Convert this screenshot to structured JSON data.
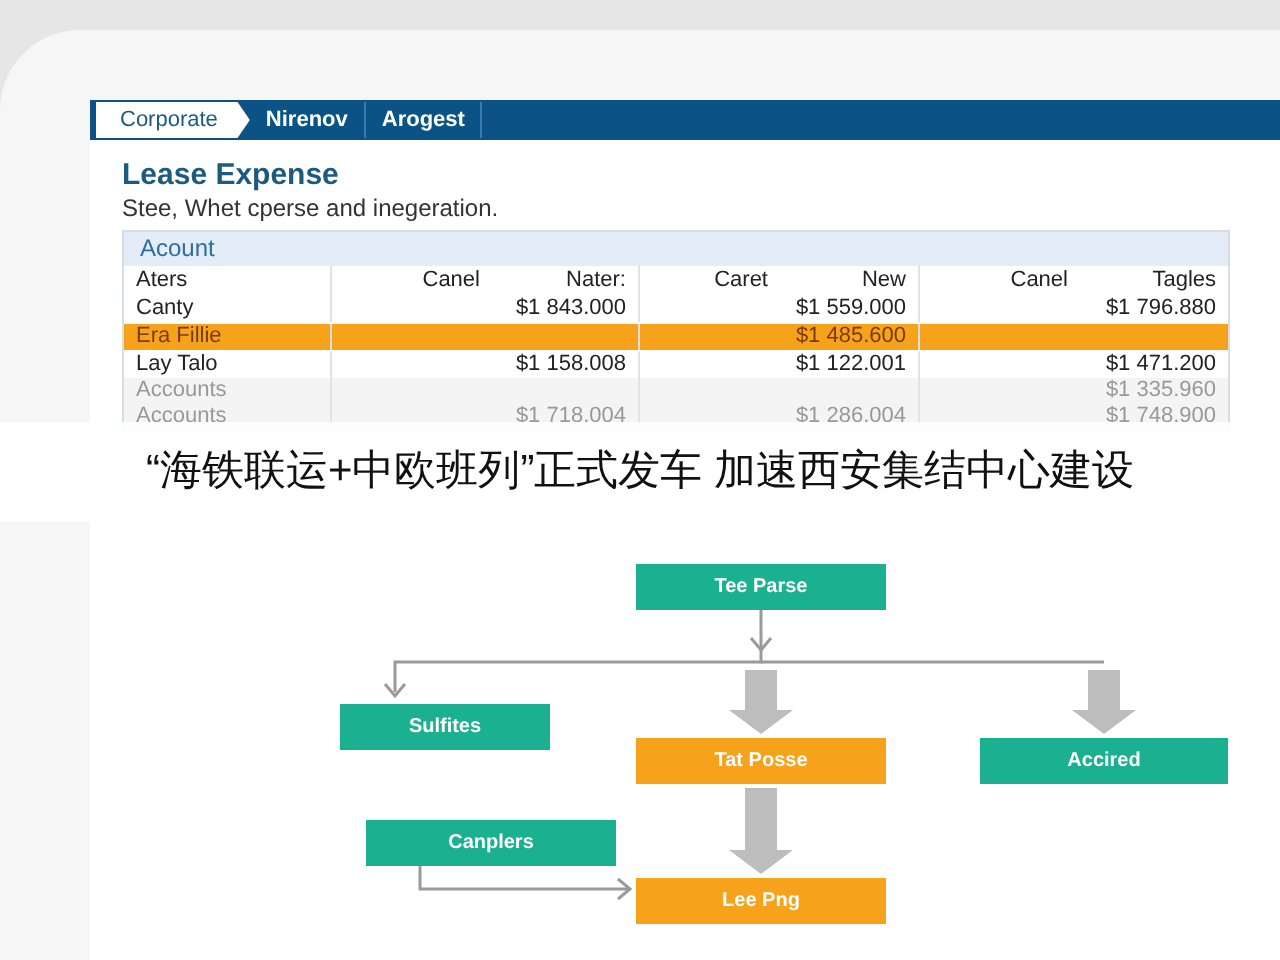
{
  "breadcrumb": [
    {
      "label": "Corporate",
      "selected": true
    },
    {
      "label": "Nirenov",
      "selected": false
    },
    {
      "label": "Arogest",
      "selected": false
    }
  ],
  "title": "Lease Expense",
  "subtitle": "Stee, Whet cperse and inegeration.",
  "table": {
    "section": "Acount",
    "columns": [
      "Aters",
      "Canel",
      "Nater:",
      "Caret",
      "New",
      "Canel",
      "Tagles"
    ],
    "rows": [
      {
        "cells": [
          "Canty",
          "",
          "$1 843.000",
          "",
          "$1 559.000",
          "",
          "$1 796.880"
        ],
        "highlighted": false
      },
      {
        "cells": [
          "Era Fillie",
          "",
          "",
          "",
          "$1 485.600",
          "",
          ""
        ],
        "highlighted": true
      },
      {
        "cells": [
          "Lay Talo",
          "",
          "$1 158.008",
          "",
          "$1 122.001",
          "",
          "$1 471.200"
        ],
        "highlighted": false
      },
      {
        "cells": [
          "Accounts",
          "",
          "",
          "",
          "",
          "",
          "$1 335.960"
        ],
        "highlighted": false
      },
      {
        "cells": [
          "Accounts",
          "",
          "$1 718.004",
          "",
          "$1 286.004",
          "",
          "$1 748.900"
        ],
        "highlighted": false
      }
    ]
  },
  "caption": "“海铁联运+中欧班列”正式发车 加速西安集结中心建设",
  "diagram": {
    "nodes": [
      {
        "label": "Tee Parse",
        "color": "#1bb08f"
      },
      {
        "label": "Sulfites",
        "color": "#1bb08f"
      },
      {
        "label": "Tat Posse",
        "color": "#f7a21b"
      },
      {
        "label": "Accired",
        "color": "#1bb08f"
      },
      {
        "label": "Canplers",
        "color": "#1bb08f"
      },
      {
        "label": "Lee Png",
        "color": "#f7a21b"
      }
    ]
  }
}
